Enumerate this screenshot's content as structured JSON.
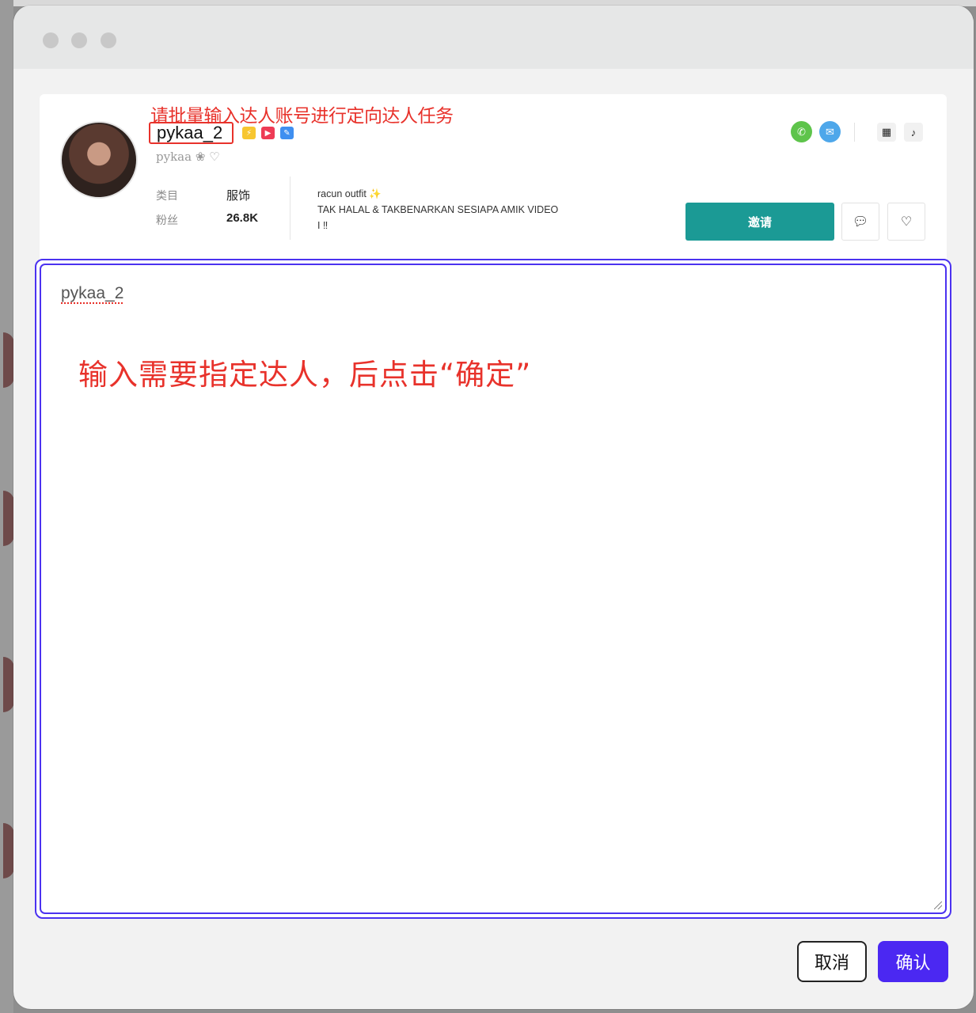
{
  "annotations": {
    "top": "请批量输入达人账号进行定向达人任务",
    "middle": "输入需要指定达人，后点击“确定”"
  },
  "influencer": {
    "name": "pykaa_2",
    "handle": "pykaa ❀ ♡",
    "category_label": "类目",
    "category_value": "服饰",
    "fans_label": "粉丝",
    "fans_value": "26.8K",
    "bio_line1": "racun outfit ✨",
    "bio_line2": "TAK HALAL & TAKBENARKAN SESIAPA AMIK VIDEO",
    "bio_line3": "I ‼"
  },
  "card_actions": {
    "invite_label": "邀请"
  },
  "icons": {
    "badge_1": "lightning-badge-icon",
    "badge_2": "video-badge-icon",
    "badge_3": "edit-badge-icon",
    "whatsapp": "whatsapp-icon",
    "email": "email-icon",
    "qr": "qr-code-icon",
    "tiktok": "tiktok-icon",
    "message": "message-icon",
    "favorite": "heart-icon"
  },
  "input": {
    "value": "pykaa_2"
  },
  "dialog_buttons": {
    "cancel_label": "取消",
    "confirm_label": "确认"
  },
  "colors": {
    "accent": "#4b28f2",
    "invite": "#1b9a95",
    "annotation": "#e8322b"
  }
}
